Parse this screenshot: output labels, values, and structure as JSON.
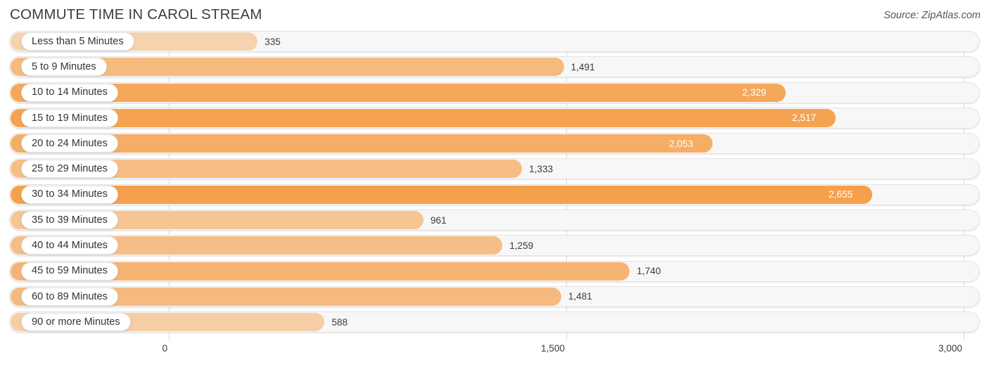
{
  "header": {
    "title": "COMMUTE TIME IN CAROL STREAM",
    "source": "Source: ZipAtlas.com"
  },
  "axis": {
    "ticks": [
      "0",
      "1,500",
      "3,000"
    ]
  },
  "chart_data": {
    "type": "bar",
    "orientation": "horizontal",
    "title": "COMMUTE TIME IN CAROL STREAM",
    "xlabel": "",
    "ylabel": "",
    "xlim": [
      0,
      3000
    ],
    "grid": true,
    "legend": false,
    "source": "Source: ZipAtlas.com",
    "categories": [
      "Less than 5 Minutes",
      "5 to 9 Minutes",
      "10 to 14 Minutes",
      "15 to 19 Minutes",
      "20 to 24 Minutes",
      "25 to 29 Minutes",
      "30 to 34 Minutes",
      "35 to 39 Minutes",
      "40 to 44 Minutes",
      "45 to 59 Minutes",
      "60 to 89 Minutes",
      "90 or more Minutes"
    ],
    "values": [
      335,
      1491,
      2329,
      2517,
      2053,
      1333,
      2655,
      961,
      1259,
      1740,
      1481,
      588
    ],
    "value_labels": [
      "335",
      "1,491",
      "2,329",
      "2,517",
      "2,053",
      "1,333",
      "2,655",
      "961",
      "1,259",
      "1,740",
      "1,481",
      "588"
    ],
    "tick_values": [
      0,
      1500,
      3000
    ],
    "tick_labels": [
      "0",
      "1,500",
      "3,000"
    ],
    "bar_color": "#f5a04b",
    "track_color": "#f7f7f7"
  }
}
